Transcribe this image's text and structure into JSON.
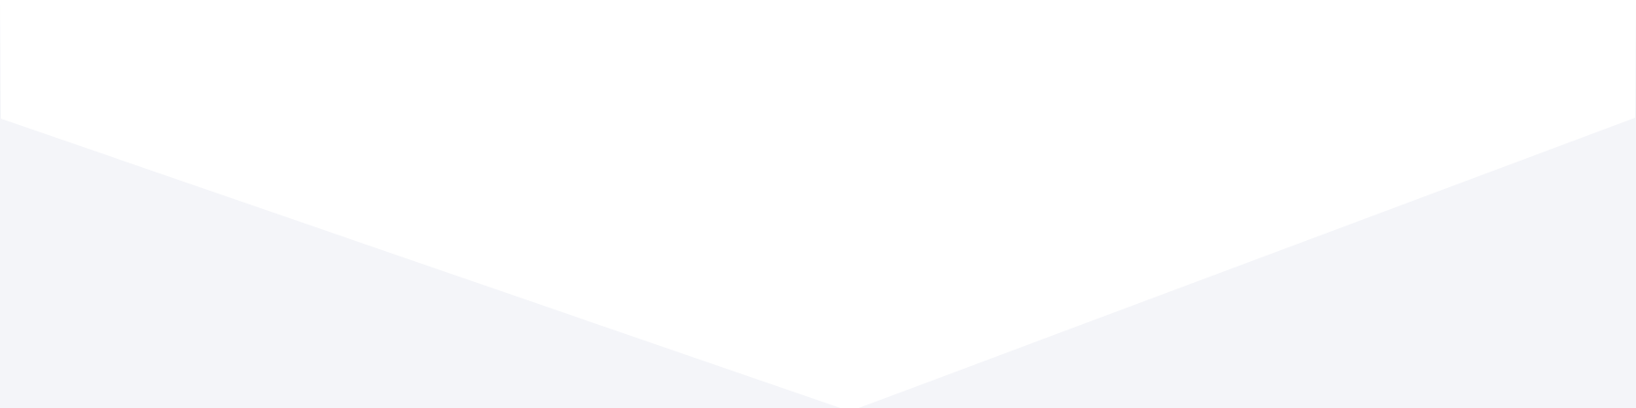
{
  "colors": {
    "page_background": "#ffffff",
    "wave_fill": "#f4f5f9"
  },
  "shapes": {
    "left_panel": "light-gray-triangle-left",
    "right_panel": "light-gray-triangle-right",
    "divider": "white-chevron-notch"
  }
}
